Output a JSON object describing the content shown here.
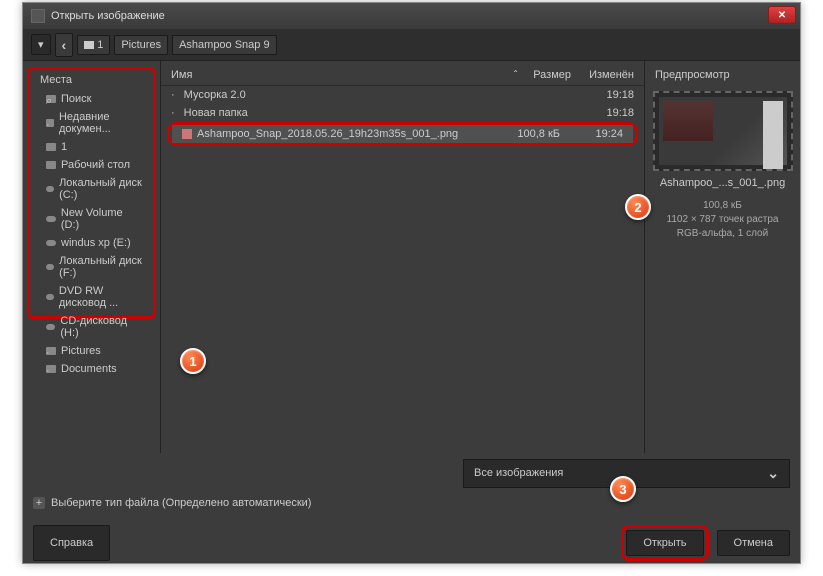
{
  "window": {
    "title": "Открыть изображение"
  },
  "breadcrumb": {
    "drive": "1",
    "folder1": "Pictures",
    "folder2": "Ashampoo Snap 9"
  },
  "sidebar": {
    "header": "Места",
    "items": [
      {
        "label": "Поиск",
        "icon": "search"
      },
      {
        "label": "Недавние докумен...",
        "icon": "dot"
      },
      {
        "label": "1",
        "icon": "folder"
      },
      {
        "label": "Рабочий стол",
        "icon": "folder"
      },
      {
        "label": "Локальный диск (C:)",
        "icon": "disk"
      },
      {
        "label": "New Volume (D:)",
        "icon": "disk"
      },
      {
        "label": "windus xp (E:)",
        "icon": "disk"
      },
      {
        "label": "Локальный диск (F:)",
        "icon": "disk"
      },
      {
        "label": "DVD RW дисковод ...",
        "icon": "disk"
      },
      {
        "label": "CD-дисковод (H:)",
        "icon": "disk"
      },
      {
        "label": "Pictures",
        "icon": "dot"
      },
      {
        "label": "Documents",
        "icon": "dot"
      }
    ]
  },
  "files": {
    "headers": {
      "name": "Имя",
      "size": "Размер",
      "modified": "Изменён"
    },
    "rows": [
      {
        "name": "Мусорка 2.0",
        "size": "",
        "modified": "19:18",
        "type": "folder",
        "selected": false
      },
      {
        "name": "Новая папка",
        "size": "",
        "modified": "19:18",
        "type": "folder",
        "selected": false
      },
      {
        "name": "Ashampoo_Snap_2018.05.26_19h23m35s_001_.png",
        "size": "100,8 кБ",
        "modified": "19:24",
        "type": "image",
        "selected": true
      }
    ]
  },
  "preview": {
    "header": "Предпросмотр",
    "filename": "Ashampoo_...s_001_.png",
    "size": "100,8 кБ",
    "dimensions": "1102 × 787 точек растра",
    "mode": "RGB-альфа, 1 слой"
  },
  "filter": {
    "label": "Все изображения"
  },
  "filetype": {
    "label": "Выберите тип файла (Определено автоматически)"
  },
  "buttons": {
    "help": "Справка",
    "open": "Открыть",
    "cancel": "Отмена"
  },
  "callouts": {
    "one": "1",
    "two": "2",
    "three": "3"
  }
}
